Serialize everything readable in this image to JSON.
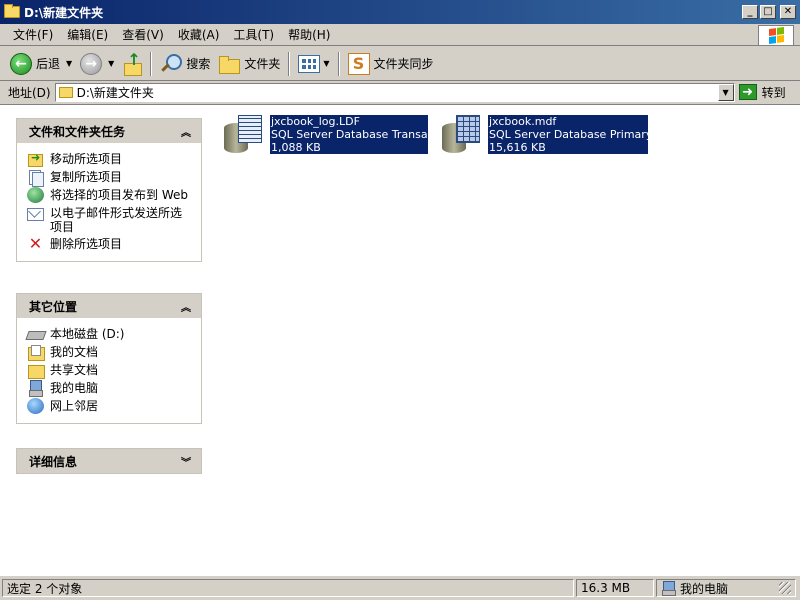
{
  "window": {
    "title": "D:\\新建文件夹",
    "minimize": "_",
    "maximize": "□",
    "close": "✕"
  },
  "menu": {
    "items": [
      "文件(F)",
      "编辑(E)",
      "查看(V)",
      "收藏(A)",
      "工具(T)",
      "帮助(H)"
    ]
  },
  "toolbar": {
    "back_label": "后退",
    "search_label": "搜索",
    "folders_label": "文件夹",
    "sync_label": "文件夹同步"
  },
  "address": {
    "label": "地址(D)",
    "value": "D:\\新建文件夹",
    "go_label": "转到"
  },
  "panels": {
    "tasks": {
      "title": "文件和文件夹任务",
      "items": [
        {
          "label": "移动所选项目",
          "icon": "move-icon"
        },
        {
          "label": "复制所选项目",
          "icon": "copy-icon"
        },
        {
          "label": "将选择的项目发布到 Web",
          "icon": "publish-web-icon"
        },
        {
          "label": "以电子邮件形式发送所选项目",
          "icon": "email-icon"
        },
        {
          "label": "删除所选项目",
          "icon": "delete-icon"
        }
      ]
    },
    "places": {
      "title": "其它位置",
      "items": [
        {
          "label": "本地磁盘 (D:)",
          "icon": "drive-icon"
        },
        {
          "label": "我的文档",
          "icon": "my-documents-icon"
        },
        {
          "label": "共享文档",
          "icon": "shared-documents-icon"
        },
        {
          "label": "我的电脑",
          "icon": "my-computer-icon"
        },
        {
          "label": "网上邻居",
          "icon": "network-icon"
        }
      ]
    },
    "details": {
      "title": "详细信息"
    }
  },
  "files": [
    {
      "name": "jxcbook_log.LDF",
      "type": "SQL Server Database Transac...",
      "size": "1,088 KB",
      "selected": true
    },
    {
      "name": "jxcbook.mdf",
      "type": "SQL Server Database Primary ...",
      "size": "15,616 KB",
      "selected": true
    }
  ],
  "status": {
    "selection": "选定 2 个对象",
    "size": "16.3 MB",
    "location": "我的电脑"
  },
  "colors": {
    "selection": "#0a246a",
    "face": "#d4d0c8"
  }
}
